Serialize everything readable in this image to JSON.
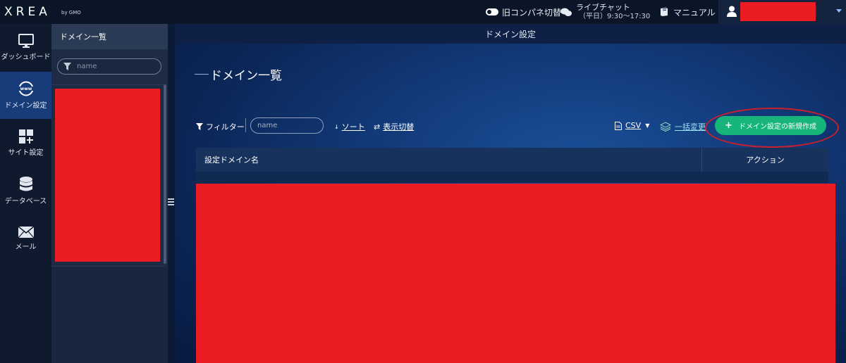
{
  "header": {
    "logo": "XREA",
    "logo_sub": "by GMO",
    "old_panel_label": "旧コンパネ切替",
    "livechat_label": "ライブチャット",
    "livechat_hours": "（平日）9:30～17:30",
    "manual_label": "マニュアル"
  },
  "leftnav": {
    "items": [
      {
        "label": "ダッシュボード",
        "icon": "monitor-icon"
      },
      {
        "label": "ドメイン設定",
        "icon": "www-globe-icon"
      },
      {
        "label": "サイト設定",
        "icon": "grid-plus-icon"
      },
      {
        "label": "データベース",
        "icon": "database-icon"
      },
      {
        "label": "メール",
        "icon": "mail-icon"
      }
    ]
  },
  "listpanel": {
    "title": "ドメイン一覧",
    "search_placeholder": "name"
  },
  "main": {
    "header_title": "ドメイン設定",
    "page_title": "ドメイン一覧",
    "toolbar": {
      "filter_label": "フィルター",
      "filter_placeholder": "name",
      "sort_label": "ソート",
      "display_toggle_label": "表示切替",
      "csv_label": "CSV",
      "bulk_change_label": "一括変更",
      "new_button_label": "ドメイン設定の新規作成"
    },
    "table": {
      "columns": [
        "設定ドメイン名",
        "アクション"
      ]
    }
  },
  "colors": {
    "accent_green": "#17b57c",
    "redaction_red": "#ec1c24",
    "nav_active": "#183c7a"
  }
}
